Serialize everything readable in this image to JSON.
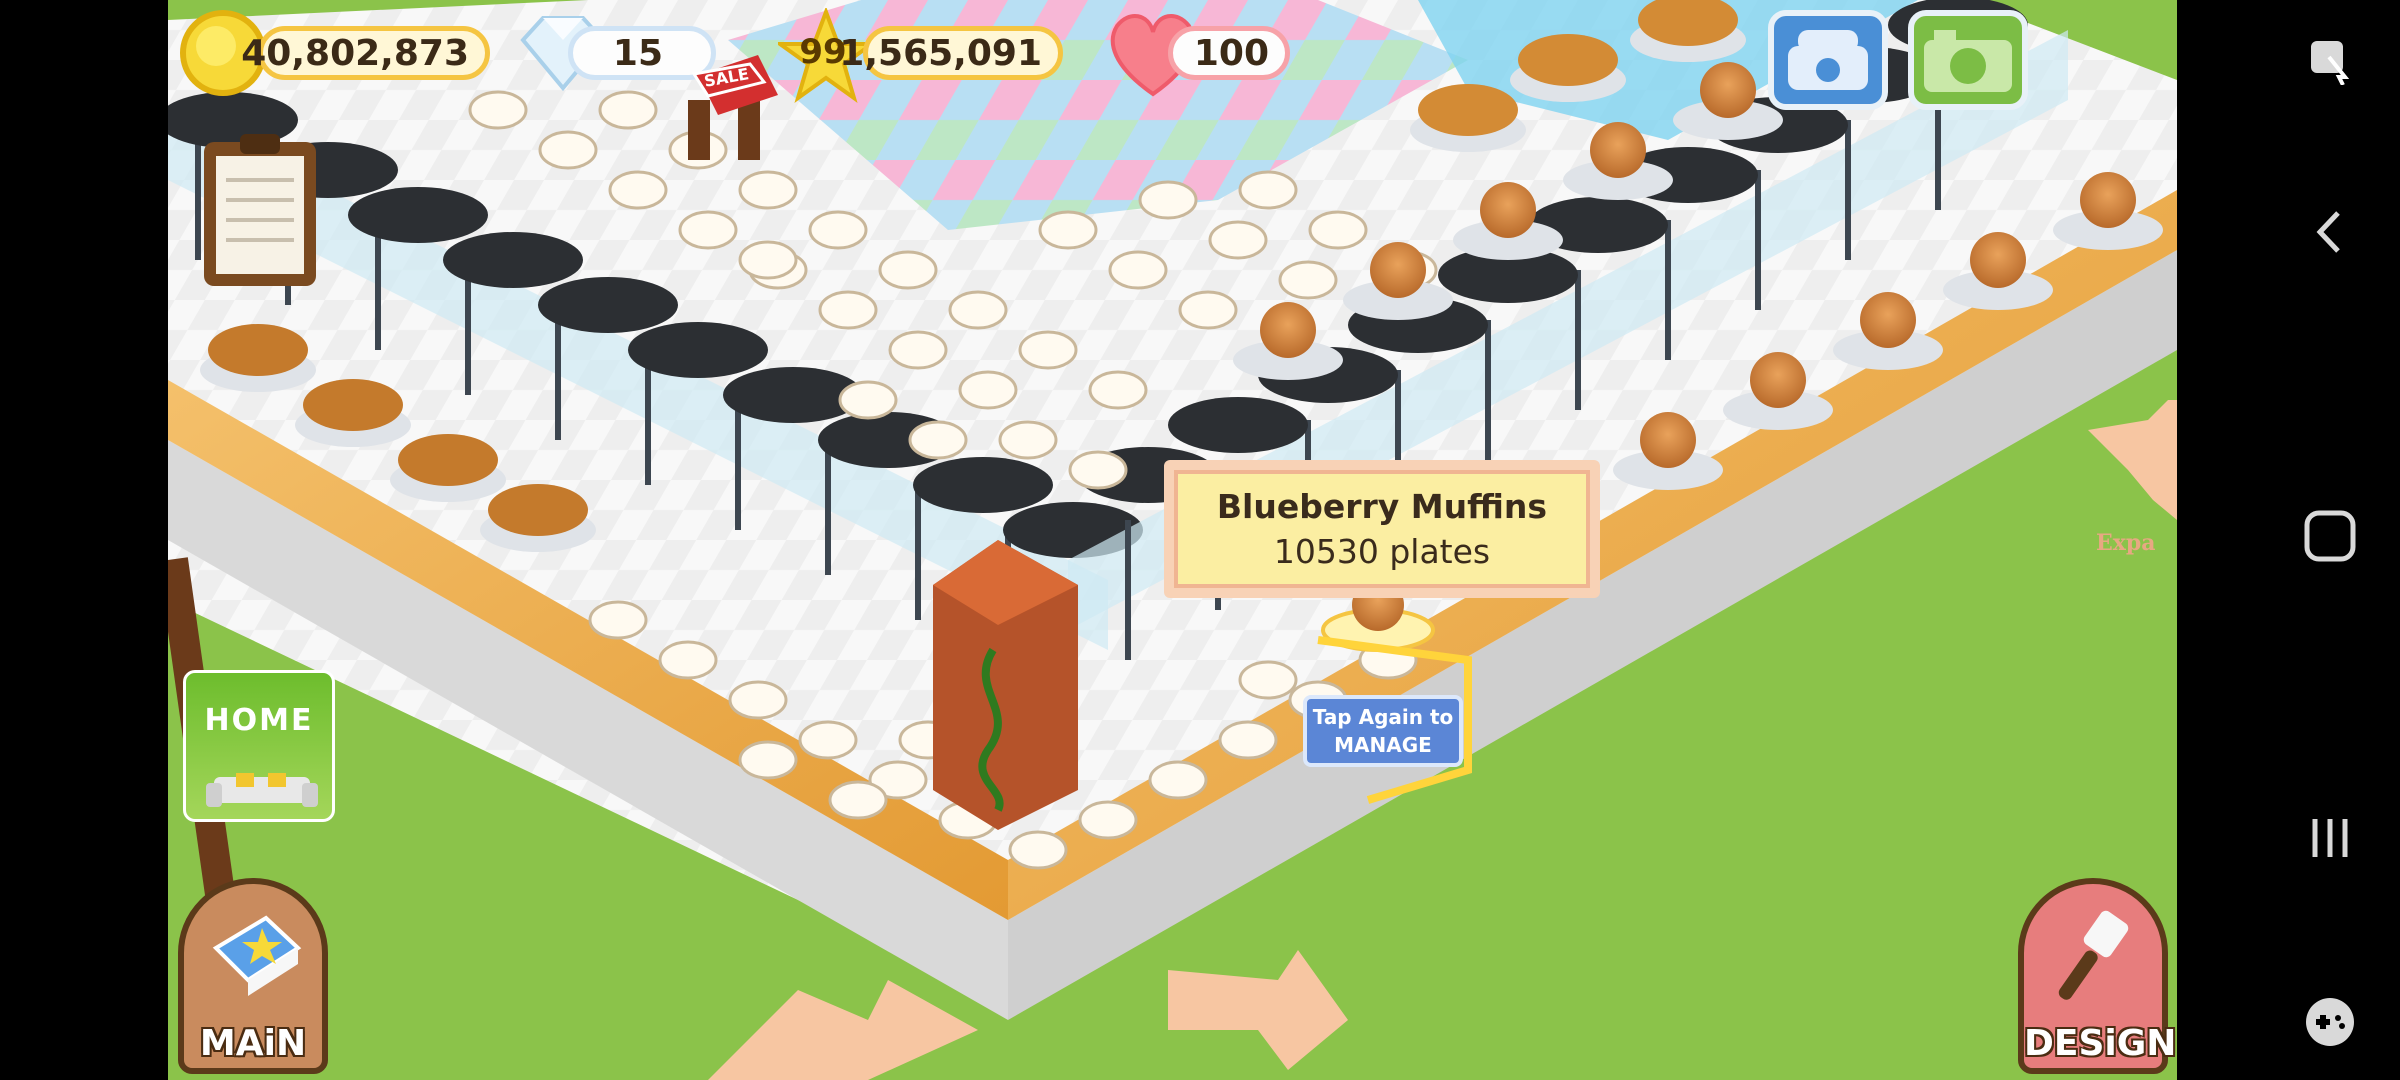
{
  "hud": {
    "coins": "40,802,873",
    "gems": "15",
    "level": "99",
    "experience": "1,565,091",
    "hearts": "100",
    "sale_label": "SALE"
  },
  "tooltip": {
    "title": "Blueberry Muffins",
    "subtitle": "10530 plates"
  },
  "tap_badge": {
    "line1": "Tap Again to",
    "line2": "MANAGE"
  },
  "buttons": {
    "home_label": "HOME",
    "main_label": "MAiN",
    "design_label": "DESiGN",
    "expand_label": "Expa"
  },
  "icons": {
    "coin": "coin-icon",
    "gem": "diamond-icon",
    "level": "star-icon",
    "heart": "heart-icon",
    "phone": "phone-icon",
    "camera": "camera-icon",
    "social": "s-logo-icon",
    "clipboard": "clipboard-icon",
    "screen_action": "accessibility-touch-icon",
    "back": "back-chevron-icon",
    "home": "home-square-icon",
    "recents": "recents-icon",
    "game_tools": "gamepad-icon"
  },
  "colors": {
    "grass": "#8bc34a",
    "counter_wood": "#f0b24a",
    "floor": "#f3f3f3",
    "accent_gold": "#f5c542"
  }
}
